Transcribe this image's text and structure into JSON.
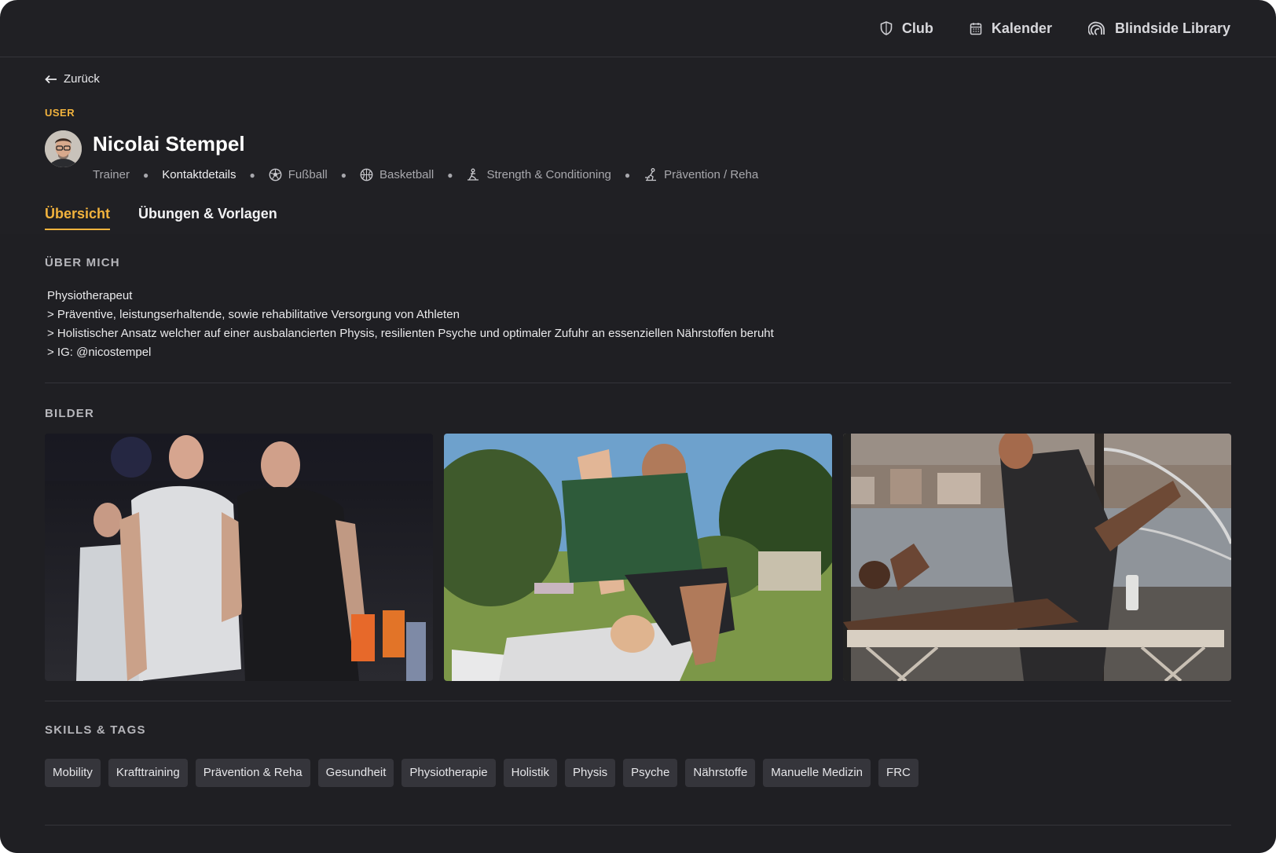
{
  "nav": {
    "club": "Club",
    "calendar": "Kalender",
    "library": "Blindside Library"
  },
  "back_label": "Zurück",
  "profile": {
    "role": "USER",
    "name": "Nicolai Stempel",
    "title": "Trainer",
    "contact": "Kontaktdetails",
    "sports": [
      "Fußball",
      "Basketball",
      "Strength & Conditioning",
      "Prävention / Reha"
    ]
  },
  "tabs": [
    "Übersicht",
    "Übungen & Vorlagen"
  ],
  "about": {
    "heading": "ÜBER MICH",
    "lines": [
      "Physiotherapeut",
      "> Präventive, leistungserhaltende, sowie rehabilitative Versorgung von Athleten",
      "> Holistischer Ansatz welcher auf einer ausbalancierten Physis, resilienten Psyche und optimaler Zufuhr an essenziellen Nährstoffen beruht",
      "> IG: @nicostempel"
    ]
  },
  "images_heading": "BILDER",
  "skills": {
    "heading": "SKILLS & TAGS",
    "tags": [
      "Mobility",
      "Krafttraining",
      "Prävention & Reha",
      "Gesundheit",
      "Physiotherapie",
      "Holistik",
      "Physis",
      "Psyche",
      "Nährstoffe",
      "Manuelle Medizin",
      "FRC"
    ]
  },
  "colors": {
    "accent": "#f2b33d",
    "background": "#202024",
    "chip": "#35353b"
  }
}
